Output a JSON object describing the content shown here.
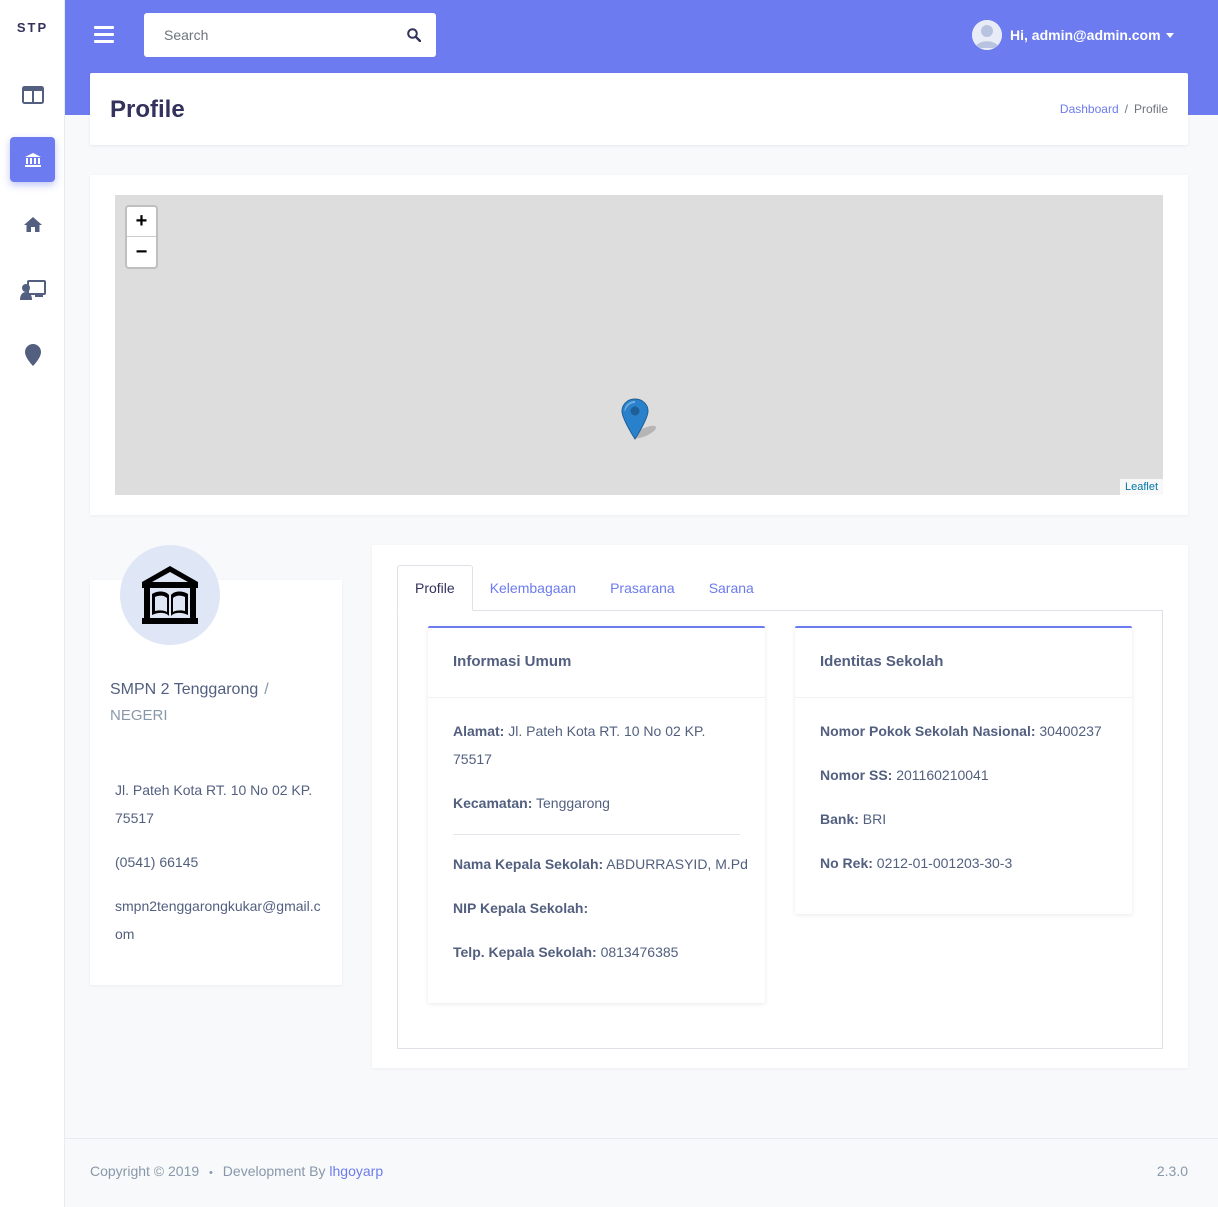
{
  "brand": "STP",
  "sidebar": {
    "items": [
      {
        "icon": "layout-icon",
        "active": false
      },
      {
        "icon": "institution-icon",
        "active": true
      },
      {
        "icon": "home-icon",
        "active": false
      },
      {
        "icon": "teacher-icon",
        "active": false
      },
      {
        "icon": "map-marker-icon",
        "active": false
      }
    ]
  },
  "header": {
    "search_placeholder": "Search",
    "user_greeting": "Hi, admin@admin.com"
  },
  "page": {
    "title": "Profile",
    "breadcrumb": {
      "home": "Dashboard",
      "separator": "/",
      "current": "Profile"
    }
  },
  "map": {
    "zoom_in": "+",
    "zoom_out": "−",
    "attribution": "Leaflet"
  },
  "school": {
    "name": "SMPN 2 Tenggarong",
    "separator": "/",
    "status": "NEGERI",
    "address": "Jl. Pateh Kota RT. 10 No 02 KP. 75517",
    "phone": "(0541) 66145",
    "email": "smpn2tenggarongkukar@gmail.com"
  },
  "tabs": [
    "Profile",
    "Kelembagaan",
    "Prasarana",
    "Sarana"
  ],
  "informasi_umum": {
    "title": "Informasi Umum",
    "alamat_label": "Alamat:",
    "alamat_value": "Jl. Pateh Kota RT. 10 No 02 KP. 75517",
    "kecamatan_label": "Kecamatan:",
    "kecamatan_value": "Tenggarong",
    "kepala_label": "Nama Kepala Sekolah:",
    "kepala_value": "ABDURRASYID, M.Pd",
    "nip_label": "NIP Kepala Sekolah:",
    "nip_value": "",
    "telp_label": "Telp. Kepala Sekolah:",
    "telp_value": "0813476385"
  },
  "identitas_sekolah": {
    "title": "Identitas Sekolah",
    "npsn_label": "Nomor Pokok Sekolah Nasional:",
    "npsn_value": "30400237",
    "nss_label": "Nomor SS:",
    "nss_value": "201160210041",
    "bank_label": "Bank:",
    "bank_value": "BRI",
    "norek_label": "No Rek:",
    "norek_value": "0212-01-001203-30-3"
  },
  "footer": {
    "copyright": "Copyright © 2019",
    "bullet": "•",
    "dev_text": "Development By",
    "dev_link": "lhgoyarp",
    "version": "2.3.0"
  },
  "colors": {
    "accent": "#6c7bef",
    "title": "#32325d",
    "text": "#525f7f",
    "map_bg": "#dddddd",
    "marker": "#2a81cb"
  }
}
